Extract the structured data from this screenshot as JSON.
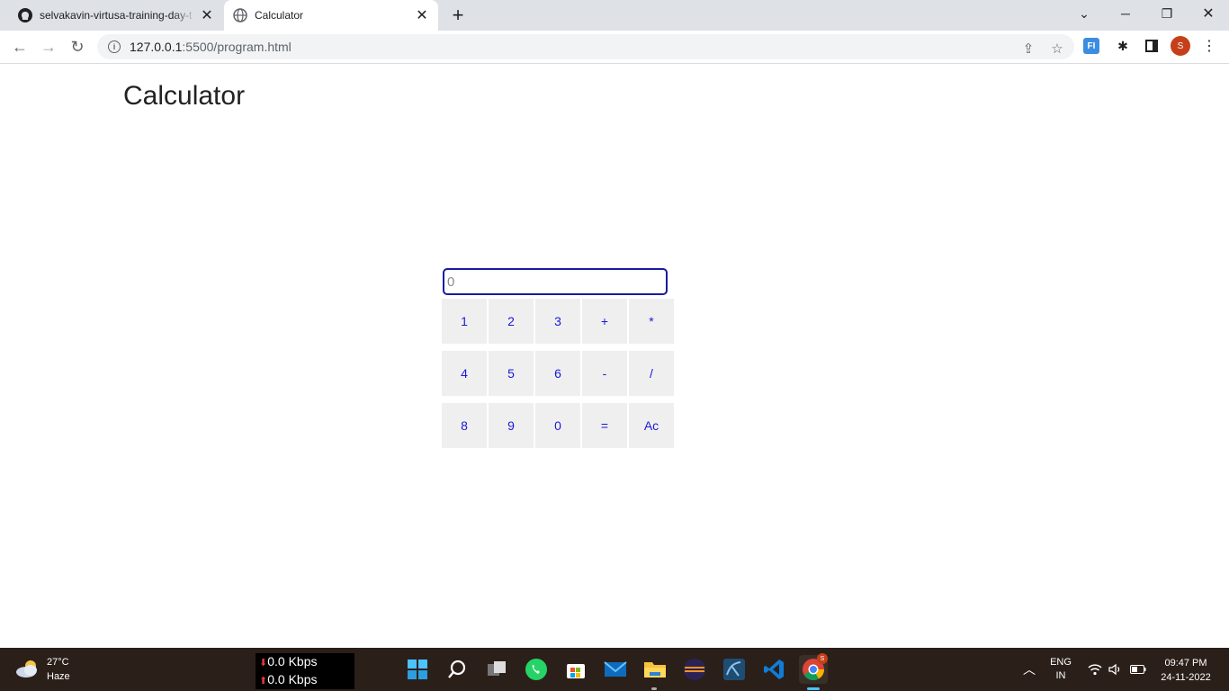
{
  "browser": {
    "tabs": [
      {
        "title": "selvakavin-virtusa-training-day-t",
        "icon": "github-icon",
        "active": false
      },
      {
        "title": "Calculator",
        "icon": "globe-icon",
        "active": true
      }
    ],
    "url_host": "127.0.0.1",
    "url_rest": ":5500/program.html",
    "profile_initial": "S",
    "extension_label": "FI"
  },
  "page": {
    "title": "Calculator",
    "display_value": "0",
    "keys": [
      "1",
      "2",
      "3",
      "+",
      "*",
      "4",
      "5",
      "6",
      "-",
      "/",
      "8",
      "9",
      "0",
      "=",
      "Ac"
    ]
  },
  "taskbar": {
    "weather_temp": "27°C",
    "weather_desc": "Haze",
    "net_down": "0.0 Kbps",
    "net_up": "0.0 Kbps",
    "lang_top": "ENG",
    "lang_bottom": "IN",
    "time": "09:47 PM",
    "date": "24-11-2022",
    "chrome_badge": "S"
  },
  "colors": {
    "accent": "#1a1aa0",
    "key_text": "#1a1ad6",
    "key_bg": "#efefef",
    "taskbar_bg": "#2b1f1a",
    "profile": "#c5401a"
  }
}
